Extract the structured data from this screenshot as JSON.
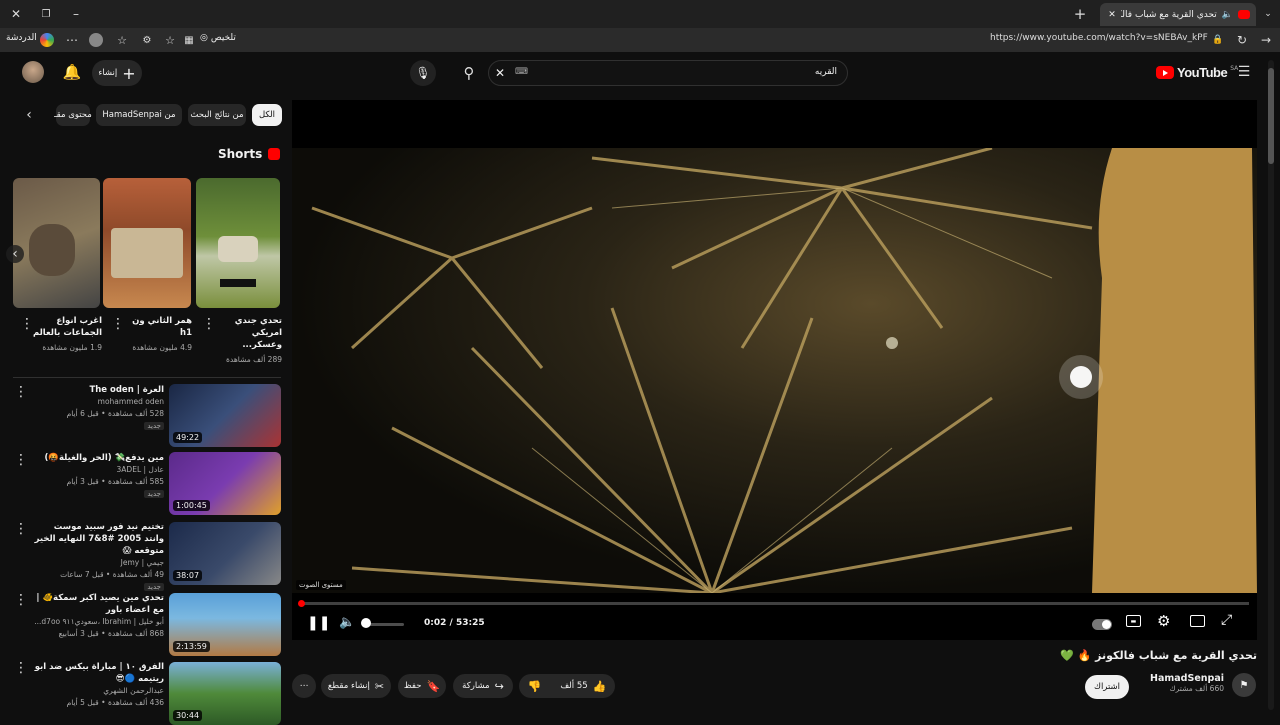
{
  "browser": {
    "tab_title": "تحدي القرية مع شباب فالكونز",
    "url": "https://www.youtube.com/watch?v=sNEBAv_kPFk",
    "summarize_label": "تلخيص",
    "chat_label": "الدردشة"
  },
  "header": {
    "logo_text": "YouTube",
    "logo_region": "SA",
    "search_value": "القريه",
    "create_label": "إنشاء"
  },
  "filters": [
    "الكل",
    "من نتائج البحث",
    "من HamadSenpai",
    "محتوى مقـ"
  ],
  "shorts": {
    "title": "Shorts",
    "items": [
      {
        "title": "تحدي جندي امريكي وعسكر...",
        "views": "289 ألف مشاهدة"
      },
      {
        "title": "همر الثاني ون h1",
        "views": "4.9 مليون مشاهدة"
      },
      {
        "title": "اغرب انواع الجماعات بالعالم",
        "views": "1.9 مليون مشاهدة"
      }
    ]
  },
  "related": [
    {
      "title": "العرة | The oden",
      "channel": "mohammed oden",
      "meta": "528 ألف مشاهدة • قبل 6 أيام",
      "badge": "جديد",
      "duration": "49:22"
    },
    {
      "title": "مين يدفع💸 (الحر والغيلة🤬)",
      "channel": "عادل | 3ADEL",
      "meta": "585 ألف مشاهدة • قبل 3 أيام",
      "badge": "جديد",
      "duration": "1:00:45"
    },
    {
      "title": "تختيم نيد فور سبيد موست وانتد 2005 #8&7 النهايه الخير متوقعه 😱",
      "channel": "جيمي | Jemy",
      "meta": "49 ألف مشاهدة • قبل 7 ساعات",
      "badge": "جديد",
      "duration": "38:07"
    },
    {
      "title": "تحدي مين يصيد اكبر سمكة🐠 | مع اعضاء باور",
      "channel": "أبو خليل | Ibrahim ،سعودي٩١١ d7oo...",
      "meta": "868 ألف مشاهدة • قبل 3 أسابيع",
      "badge": "",
      "duration": "2:13:59"
    },
    {
      "title": "الفرق ١٠ | مباراة بيكس ضد ابو ريتيمه 🔵😎",
      "channel": "عبدالرحمن الشهري",
      "meta": "436 ألف مشاهدة • قبل 5 أيام",
      "badge": "",
      "duration": "30:44"
    }
  ],
  "player": {
    "time": "0:02 / 53:25",
    "volume_tooltip": "مستوى الصوت",
    "progress": 0.001,
    "volume": 0.15
  },
  "video": {
    "title": "تحدي القرية مع شباب فالكونز 🔥 💚",
    "channel": "HamadSenpai",
    "subscribers": "660 ألف مشترك",
    "subscribe_label": "اشتراك",
    "likes": "55 ألف",
    "share_label": "مشاركة",
    "save_label": "حفظ",
    "clip_label": "إنشاء مقطع"
  }
}
